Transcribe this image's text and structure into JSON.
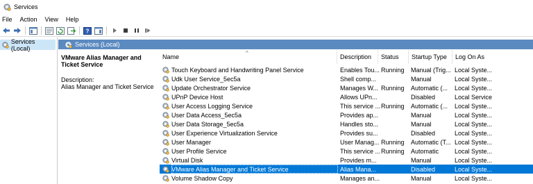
{
  "window": {
    "title": "Services"
  },
  "menu": [
    "File",
    "Action",
    "View",
    "Help"
  ],
  "toolbar": {
    "icons": [
      "back-icon",
      "forward-icon",
      "show-hide-tree-icon",
      "properties-icon",
      "refresh-icon",
      "export-list-icon",
      "help-icon",
      "show-hide-action-pane-icon",
      "start-icon",
      "stop-icon",
      "pause-icon",
      "restart-icon"
    ]
  },
  "tree": {
    "selected_label": "Services (Local)"
  },
  "pane": {
    "header_label": "Services (Local)",
    "selected_title": "VMware Alias Manager and Ticket Service",
    "description_label": "Description:",
    "description_text": "Alias Manager and Ticket Service"
  },
  "columns": {
    "name": "Name",
    "description": "Description",
    "status": "Status",
    "startup": "Startup Type",
    "logon": "Log On As"
  },
  "colors": {
    "accent": "#0078d7",
    "pane_header": "#5b8ac0",
    "tree_selected": "#cde6f7"
  },
  "rows": [
    {
      "name": "Touch Keyboard and Handwriting Panel Service",
      "description": "Enables Tou...",
      "status": "Running",
      "startup": "Manual (Trig...",
      "logon": "Local Syste...",
      "selected": false
    },
    {
      "name": "Udk User Service_5ec5a",
      "description": "Shell comp...",
      "status": "",
      "startup": "Manual",
      "logon": "Local Syste...",
      "selected": false
    },
    {
      "name": "Update Orchestrator Service",
      "description": "Manages W...",
      "status": "Running",
      "startup": "Automatic (...",
      "logon": "Local Syste...",
      "selected": false
    },
    {
      "name": "UPnP Device Host",
      "description": "Allows UPn...",
      "status": "",
      "startup": "Disabled",
      "logon": "Local Service",
      "selected": false
    },
    {
      "name": "User Access Logging Service",
      "description": "This service ...",
      "status": "Running",
      "startup": "Automatic (...",
      "logon": "Local Syste...",
      "selected": false
    },
    {
      "name": "User Data Access_5ec5a",
      "description": "Provides ap...",
      "status": "",
      "startup": "Manual",
      "logon": "Local Syste...",
      "selected": false
    },
    {
      "name": "User Data Storage_5ec5a",
      "description": "Handles sto...",
      "status": "",
      "startup": "Manual",
      "logon": "Local Syste...",
      "selected": false
    },
    {
      "name": "User Experience Virtualization Service",
      "description": "Provides su...",
      "status": "",
      "startup": "Disabled",
      "logon": "Local Syste...",
      "selected": false
    },
    {
      "name": "User Manager",
      "description": "User Manag...",
      "status": "Running",
      "startup": "Automatic (T...",
      "logon": "Local Syste...",
      "selected": false
    },
    {
      "name": "User Profile Service",
      "description": "This service ...",
      "status": "Running",
      "startup": "Automatic",
      "logon": "Local Syste...",
      "selected": false
    },
    {
      "name": "Virtual Disk",
      "description": "Provides m...",
      "status": "",
      "startup": "Manual",
      "logon": "Local Syste...",
      "selected": false
    },
    {
      "name": "VMware Alias Manager and Ticket Service",
      "description": "Alias Mana...",
      "status": "",
      "startup": "Disabled",
      "logon": "Local Syste...",
      "selected": true
    },
    {
      "name": "Volume Shadow Copy",
      "description": "Manages an...",
      "status": "",
      "startup": "Manual",
      "logon": "Local Syste...",
      "selected": false
    }
  ]
}
